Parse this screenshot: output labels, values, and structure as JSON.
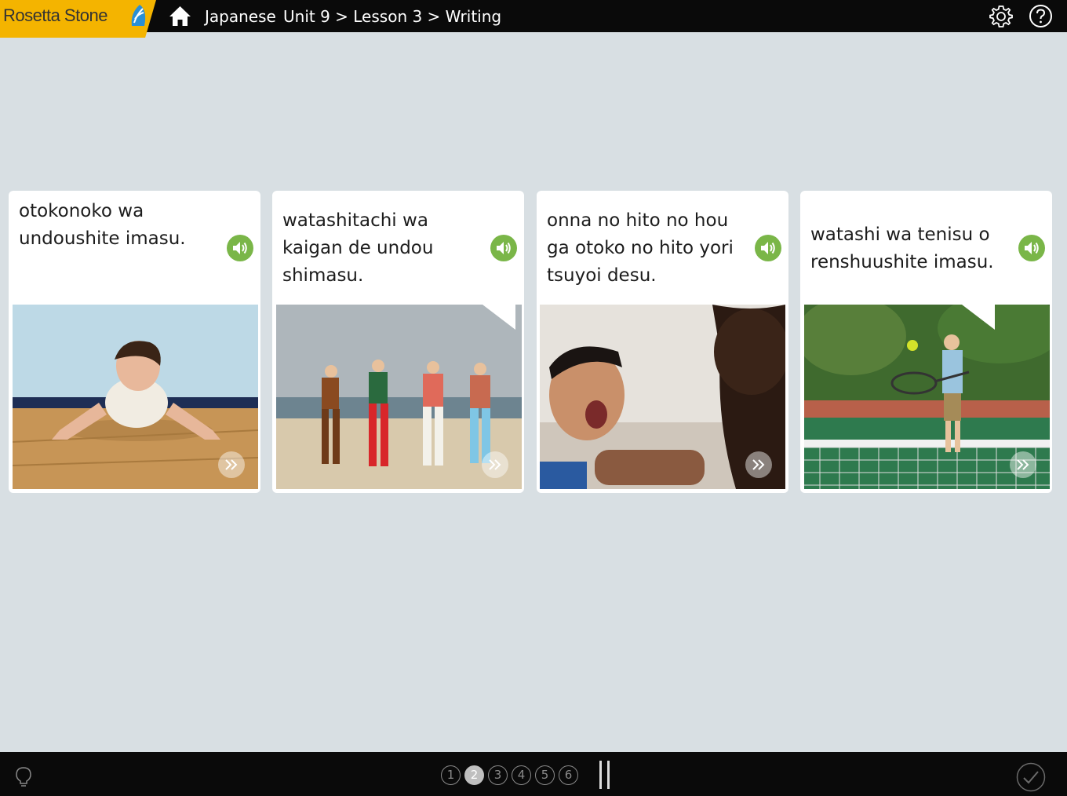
{
  "app": {
    "logo_text": "Rosetta Stone"
  },
  "header": {
    "language": "Japanese",
    "breadcrumb": "Unit 9 > Lesson 3 > Writing"
  },
  "cards": [
    {
      "text": "otokonoko wa\nundoushite imasu.",
      "image": "boy doing push-ups"
    },
    {
      "text": "watashitachi wa\nkaigan de undou\nshimasu.",
      "image": "people exercising on beach"
    },
    {
      "text": "onna no hito no hou\nga otoko no hito yori\ntsuyoi desu.",
      "image": "woman and man arm wrestling"
    },
    {
      "text": "watashi wa tenisu o\nrenshuushite imasu.",
      "image": "boy playing tennis"
    }
  ],
  "footer": {
    "steps": [
      "1",
      "2",
      "3",
      "4",
      "5",
      "6"
    ],
    "active_step": "2"
  },
  "colors": {
    "background": "#d8dfe3",
    "bar": "#0a0a0a",
    "logo": "#f4b400",
    "audio": "#7ab648"
  },
  "icons": [
    "home-icon",
    "gear-icon",
    "help-icon",
    "audio-icon",
    "next-icon",
    "hint-icon",
    "pause-icon",
    "check-icon"
  ]
}
